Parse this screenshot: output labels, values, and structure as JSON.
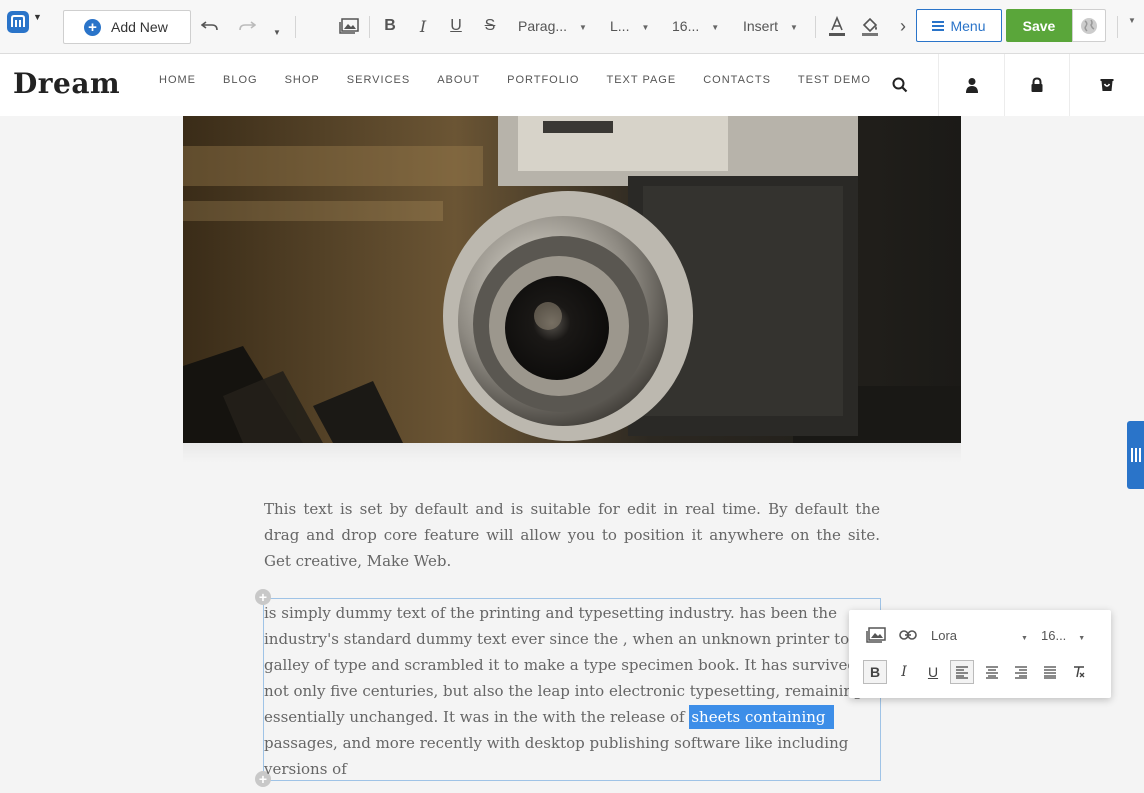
{
  "toolbar": {
    "add_new_label": "Add New",
    "paragraph_select": "Parag...",
    "font_select": "L...",
    "size_select": "16...",
    "insert_label": "Insert",
    "menu_label": "Menu",
    "save_label": "Save"
  },
  "header": {
    "brand": "Dream",
    "nav": [
      "HOME",
      "BLOG",
      "SHOP",
      "SERVICES",
      "ABOUT",
      "PORTFOLIO",
      "TEXT PAGE",
      "CONTACTS",
      "TEST DEMO"
    ]
  },
  "content": {
    "paragraph1": "This text is set by default and is suitable for edit in real time. By default the drag and drop core feature will allow you to position it anywhere on the site. Get creative, Make Web.",
    "paragraph2_before": "is simply dummy text of the printing and typesetting industry. has been the industry's standard dummy text ever since the , when an unknown printer took a galley of type and scrambled it to make a type specimen book. It has survived not only five centuries, but also the leap into electronic typesetting, remaining essentially unchanged. It was  in the  with the release of ",
    "paragraph2_selected": "sheets containing",
    "paragraph2_after": " passages, and more recently with desktop publishing software like  including versions of"
  },
  "inline_toolbar": {
    "font": "Lora",
    "size": "16..."
  },
  "colors": {
    "accent": "#2a74c9",
    "save": "#5aa63a",
    "selection": "#3d8ee8"
  },
  "icons": [
    "logo-icon",
    "undo-icon",
    "redo-icon",
    "image-icon",
    "bold-icon",
    "italic-icon",
    "underline-icon",
    "strikethrough-icon",
    "font-color-icon",
    "fill-color-icon",
    "chevron-right-icon",
    "globe-icon",
    "search-icon",
    "user-icon",
    "lock-icon",
    "cart-icon",
    "link-icon",
    "align-left-icon",
    "align-center-icon",
    "align-right-icon",
    "align-justify-icon",
    "clear-format-icon"
  ]
}
